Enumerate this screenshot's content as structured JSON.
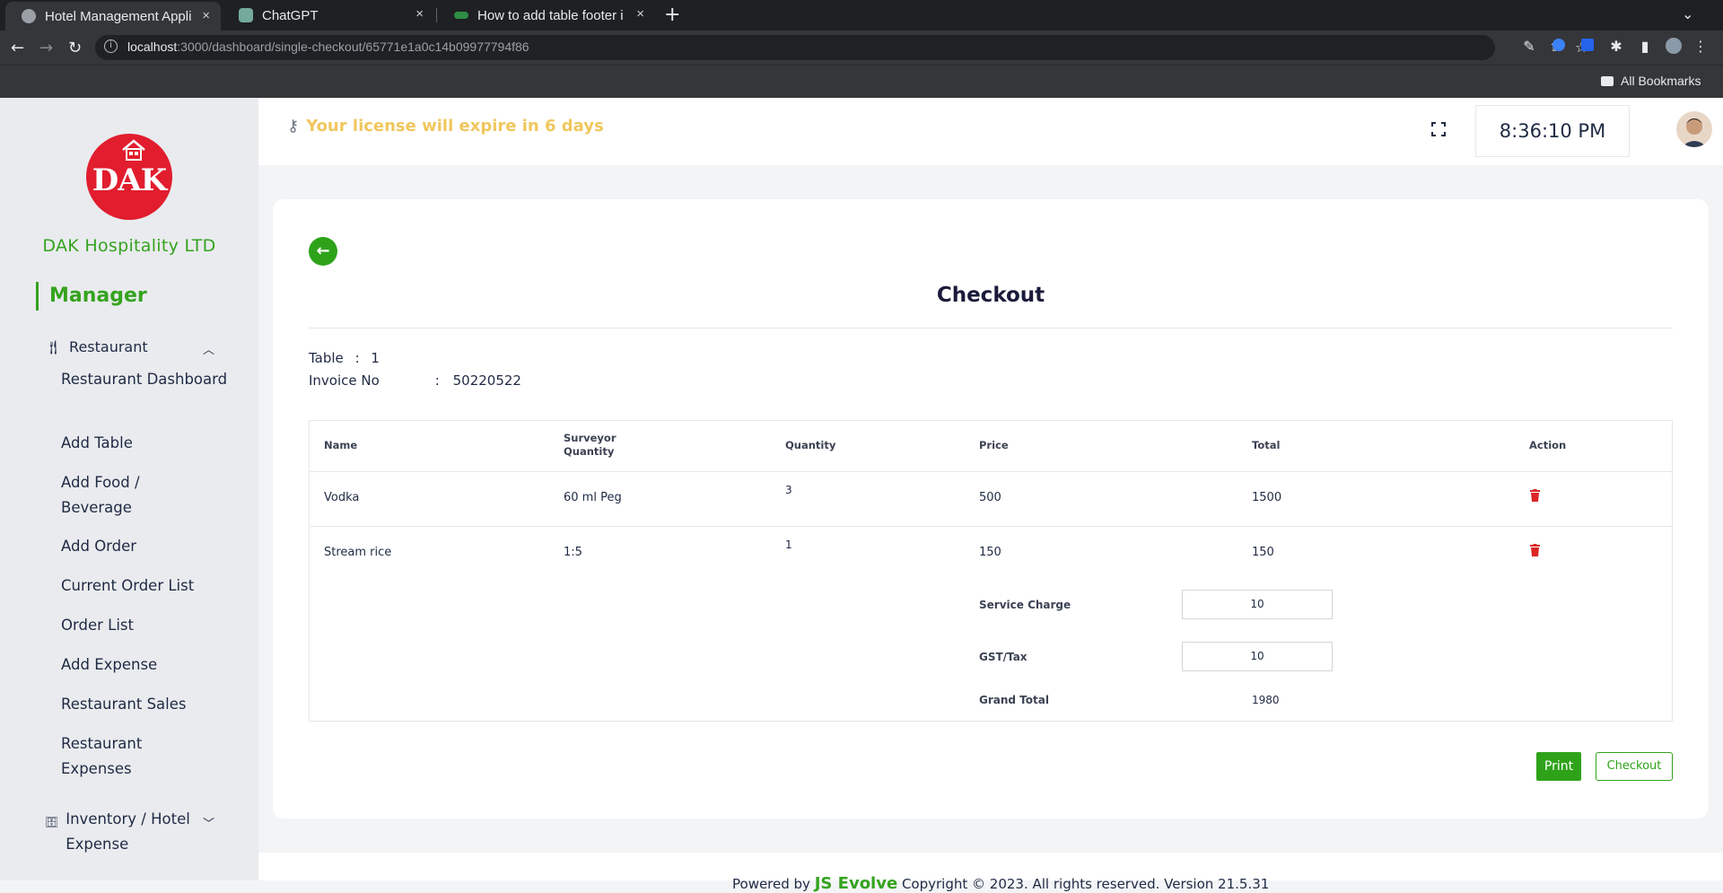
{
  "browser": {
    "tabs": [
      {
        "title": "Hotel Management Appli",
        "active": true,
        "close": "×"
      },
      {
        "title": "ChatGPT",
        "active": false,
        "close": "×"
      },
      {
        "title": "How to add table footer i",
        "active": false,
        "close": "×"
      }
    ],
    "new_tab": "+",
    "url_host": "localhost",
    "url_rest": ":3000/dashboard/single-checkout/65771e1a0c14b09977794f86",
    "bookmarks_label": "All Bookmarks"
  },
  "sidebar": {
    "logo_text": "DAK",
    "company": "DAK Hospitality LTD",
    "role": "Manager",
    "restaurant_section": "Restaurant",
    "items": [
      {
        "label": "Restaurant Dashboard"
      },
      {
        "label": "Add Table"
      },
      {
        "label": "Add Food / Beverage"
      },
      {
        "label": "Add Order"
      },
      {
        "label": "Current Order List"
      },
      {
        "label": "Order List"
      },
      {
        "label": "Add Expense"
      },
      {
        "label": "Restaurant Sales"
      },
      {
        "label": "Restaurant Expenses"
      }
    ],
    "inventory_section": "Inventory / Hotel Expense"
  },
  "header": {
    "license_text": "Your license will expire in 6 days",
    "clock": "8:36:10 PM"
  },
  "checkout": {
    "title": "Checkout",
    "table_label": "Table",
    "table_sep": ":",
    "table_value": "1",
    "invoice_label": "Invoice No",
    "invoice_sep": ":",
    "invoice_value": "50220522",
    "columns": [
      "Name",
      "Surveyor Quantity",
      "Quantity",
      "Price",
      "Total",
      "Action"
    ],
    "rows": [
      {
        "name": "Vodka",
        "surveyor_quantity": "60 ml Peg",
        "quantity": "3",
        "price": "500",
        "total": "1500"
      },
      {
        "name": "Stream rice",
        "surveyor_quantity": "1:5",
        "quantity": "1",
        "price": "150",
        "total": "150"
      }
    ],
    "service_charge_label": "Service Charge",
    "service_charge_value": "10",
    "gst_label": "GST/Tax",
    "gst_value": "10",
    "grand_total_label": "Grand Total",
    "grand_total_value": "1980",
    "print_label": "Print",
    "checkout_label": "Checkout"
  },
  "footer": {
    "prefix": "Powered by",
    "brand": "JS Evolve",
    "copyright": "Copyright © 2023. All rights reserved. Version 21.5.31"
  },
  "colors": {
    "accent_green": "#2ea31a",
    "license_yellow": "#f0c75e",
    "logo_red": "#e11d2e",
    "trash_red": "#dc2626"
  }
}
